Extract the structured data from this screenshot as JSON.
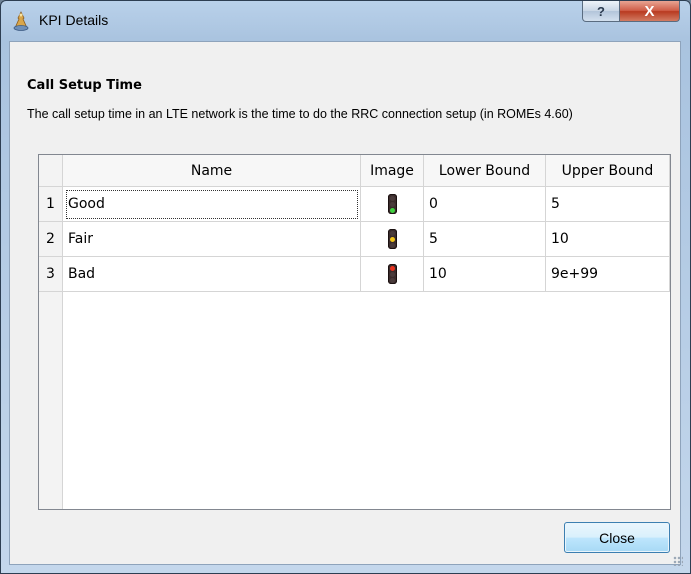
{
  "window": {
    "title": "KPI Details",
    "help_glyph": "?",
    "close_glyph": "X"
  },
  "kpi": {
    "name": "Call Setup Time",
    "description": "The call setup time in an LTE network is the time to do the RRC connection setup (in ROMEs 4.60)"
  },
  "table": {
    "columns": [
      "Name",
      "Image",
      "Lower Bound",
      "Upper Bound"
    ],
    "rows": [
      {
        "index": "1",
        "name": "Good",
        "image": "traffic-light-green-icon",
        "lower": "0",
        "upper": "5"
      },
      {
        "index": "2",
        "name": "Fair",
        "image": "traffic-light-yellow-icon",
        "lower": "5",
        "upper": "10"
      },
      {
        "index": "3",
        "name": "Bad",
        "image": "traffic-light-red-icon",
        "lower": "10",
        "upper": "9e+99"
      }
    ]
  },
  "footer": {
    "close_label": "Close"
  },
  "colors": {
    "green_lamp": "#3fd13f",
    "yellow_lamp": "#f2c418",
    "red_lamp": "#e8321f"
  }
}
